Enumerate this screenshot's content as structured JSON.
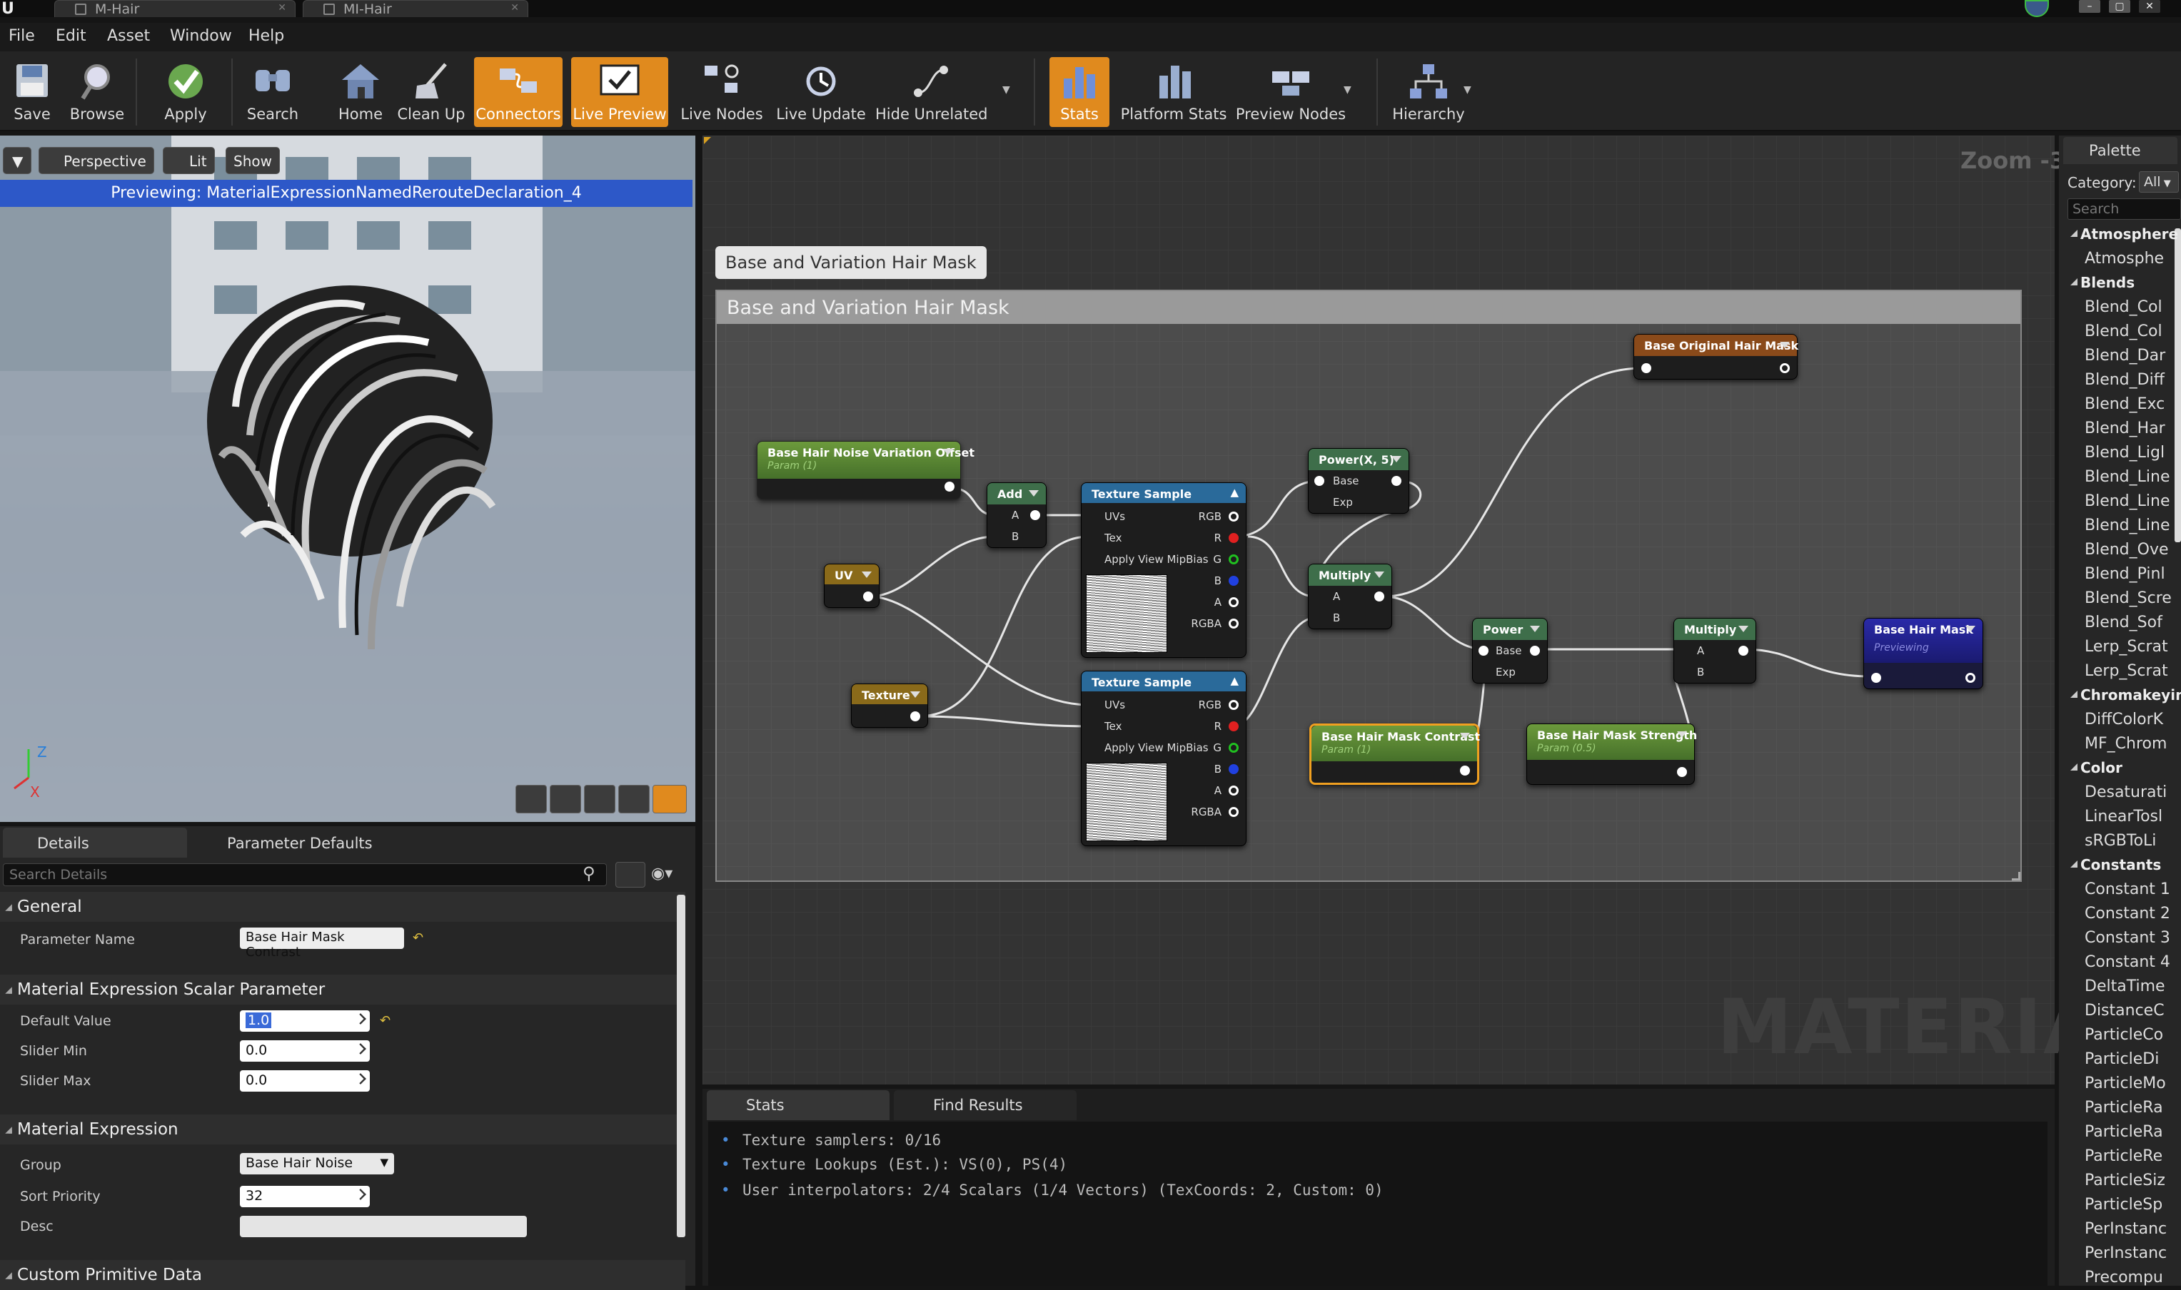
{
  "window": {
    "tabs": [
      {
        "label": "M-Hair"
      },
      {
        "label": "MI-Hair"
      }
    ]
  },
  "menu": [
    "File",
    "Edit",
    "Asset",
    "Window",
    "Help"
  ],
  "toolbar": {
    "save": "Save",
    "browse": "Browse",
    "apply": "Apply",
    "search": "Search",
    "home": "Home",
    "cleanup": "Clean Up",
    "connectors": "Connectors",
    "live_preview": "Live Preview",
    "live_nodes": "Live Nodes",
    "live_update": "Live Update",
    "hide_unrelated": "Hide Unrelated",
    "stats": "Stats",
    "platform_stats": "Platform Stats",
    "preview_nodes": "Preview Nodes",
    "hierarchy": "Hierarchy"
  },
  "viewport": {
    "perspective": "Perspective",
    "lit": "Lit",
    "show": "Show",
    "previewing": "Previewing: MaterialExpressionNamedRerouteDeclaration_4",
    "axis_z": "Z",
    "axis_x": "X"
  },
  "details": {
    "tabs": {
      "details": "Details",
      "parameter_defaults": "Parameter Defaults"
    },
    "search_placeholder": "Search Details",
    "general": "General",
    "parameter_name_label": "Parameter Name",
    "parameter_name_value": "Base Hair Mask Contrast",
    "scalar_section": "Material Expression Scalar Parameter",
    "default_value_label": "Default Value",
    "default_value": "1.0",
    "slider_min_label": "Slider Min",
    "slider_min": "0.0",
    "slider_max_label": "Slider Max",
    "slider_max": "0.0",
    "expression_section": "Material Expression",
    "group_label": "Group",
    "group_value": "Base Hair Noise",
    "sort_priority_label": "Sort Priority",
    "sort_priority": "32",
    "desc_label": "Desc",
    "custom_section": "Custom Primitive Data"
  },
  "graph": {
    "zoom": "Zoom -3",
    "watermark": "MATERIAL",
    "comment_bubble": "Base and Variation Hair Mask",
    "comment_title": "Base and Variation Hair Mask",
    "nodes": {
      "noise_offset": {
        "title": "Base Hair Noise Variation Offset",
        "sub": "Param (1)"
      },
      "add": {
        "title": "Add",
        "a": "A",
        "b": "B"
      },
      "uv": {
        "title": "UV"
      },
      "texture": {
        "title": "Texture"
      },
      "ts1": {
        "title": "Texture Sample",
        "uvs": "UVs",
        "tex": "Tex",
        "mip": "Apply View MipBias",
        "rgb": "RGB",
        "r": "R",
        "g": "G",
        "b": "B",
        "a": "A",
        "rgba": "RGBA"
      },
      "ts2": {
        "title": "Texture Sample",
        "uvs": "UVs",
        "tex": "Tex",
        "mip": "Apply View MipBias",
        "rgb": "RGB",
        "r": "R",
        "g": "G",
        "b": "B",
        "a": "A",
        "rgba": "RGBA"
      },
      "pow": {
        "title": "Power(X, 5)",
        "base": "Base",
        "exp": "Exp"
      },
      "mul1": {
        "title": "Multiply",
        "a": "A",
        "b": "B"
      },
      "original": {
        "title": "Base Original Hair Mask"
      },
      "power": {
        "title": "Power",
        "base": "Base",
        "exp": "Exp"
      },
      "contrast": {
        "title": "Base Hair Mask Contrast",
        "sub": "Param (1)"
      },
      "strength": {
        "title": "Base Hair Mask Strength",
        "sub": "Param (0.5)"
      },
      "mul2": {
        "title": "Multiply",
        "a": "A",
        "b": "B"
      },
      "output": {
        "title": "Base Hair Mask",
        "sub": "Previewing"
      }
    }
  },
  "stats": {
    "tabs": {
      "stats": "Stats",
      "find": "Find Results"
    },
    "lines": [
      "Texture samplers: 0/16",
      "Texture Lookups (Est.): VS(0), PS(4)",
      "User interpolators: 2/4 Scalars (1/4 Vectors) (TexCoords: 2, Custom: 0)"
    ]
  },
  "palette": {
    "title": "Palette",
    "category_label": "Category:",
    "category_value": "All",
    "search_placeholder": "Search",
    "items": [
      {
        "t": "c",
        "l": "Atmosphere"
      },
      {
        "t": "i",
        "l": "Atmosphe"
      },
      {
        "t": "c",
        "l": "Blends"
      },
      {
        "t": "i",
        "l": "Blend_Col"
      },
      {
        "t": "i",
        "l": "Blend_Col"
      },
      {
        "t": "i",
        "l": "Blend_Dar"
      },
      {
        "t": "i",
        "l": "Blend_Diff"
      },
      {
        "t": "i",
        "l": "Blend_Exc"
      },
      {
        "t": "i",
        "l": "Blend_Har"
      },
      {
        "t": "i",
        "l": "Blend_Ligl"
      },
      {
        "t": "i",
        "l": "Blend_Line"
      },
      {
        "t": "i",
        "l": "Blend_Line"
      },
      {
        "t": "i",
        "l": "Blend_Line"
      },
      {
        "t": "i",
        "l": "Blend_Ove"
      },
      {
        "t": "i",
        "l": "Blend_Pinl"
      },
      {
        "t": "i",
        "l": "Blend_Scre"
      },
      {
        "t": "i",
        "l": "Blend_Sof"
      },
      {
        "t": "i",
        "l": "Lerp_Scrat"
      },
      {
        "t": "i",
        "l": "Lerp_Scrat"
      },
      {
        "t": "c",
        "l": "Chromakeyin"
      },
      {
        "t": "i",
        "l": "DiffColorK"
      },
      {
        "t": "i",
        "l": "MF_Chrom"
      },
      {
        "t": "c",
        "l": "Color"
      },
      {
        "t": "i",
        "l": "Desaturati"
      },
      {
        "t": "i",
        "l": "LinearTosl"
      },
      {
        "t": "i",
        "l": "sRGBToLi"
      },
      {
        "t": "c",
        "l": "Constants"
      },
      {
        "t": "i",
        "l": "Constant 1"
      },
      {
        "t": "i",
        "l": "Constant 2"
      },
      {
        "t": "i",
        "l": "Constant 3"
      },
      {
        "t": "i",
        "l": "Constant 4"
      },
      {
        "t": "i",
        "l": "DeltaTime"
      },
      {
        "t": "i",
        "l": "DistanceC"
      },
      {
        "t": "i",
        "l": "ParticleCo"
      },
      {
        "t": "i",
        "l": "ParticleDi"
      },
      {
        "t": "i",
        "l": "ParticleMo"
      },
      {
        "t": "i",
        "l": "ParticleRa"
      },
      {
        "t": "i",
        "l": "ParticleRa"
      },
      {
        "t": "i",
        "l": "ParticleRe"
      },
      {
        "t": "i",
        "l": "ParticleSiz"
      },
      {
        "t": "i",
        "l": "ParticleSp"
      },
      {
        "t": "i",
        "l": "PerInstanc"
      },
      {
        "t": "i",
        "l": "PerInstanc"
      },
      {
        "t": "i",
        "l": "Precompu"
      }
    ]
  },
  "colors": {
    "accent": "#e08a1e",
    "preview_banner": "#2d58c8",
    "param_node": "#5a8a30",
    "texture_node": "#2a6a9a",
    "math_node": "#3e6e4a"
  }
}
